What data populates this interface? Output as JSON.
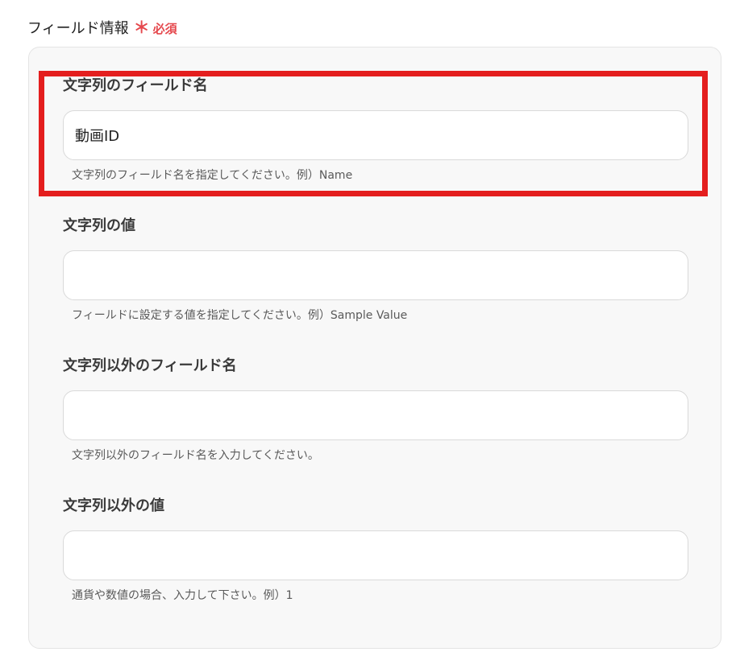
{
  "section": {
    "title": "フィールド情報",
    "required_mark": "＊",
    "required_text": "必須"
  },
  "fields": [
    {
      "label": "文字列のフィールド名",
      "value": "動画ID",
      "placeholder": "",
      "hint": "文字列のフィールド名を指定してください。例）Name"
    },
    {
      "label": "文字列の値",
      "value": "",
      "placeholder": "",
      "hint": "フィールドに設定する値を指定してください。例）Sample Value"
    },
    {
      "label": "文字列以外のフィールド名",
      "value": "",
      "placeholder": "",
      "hint": "文字列以外のフィールド名を入力してください。"
    },
    {
      "label": "文字列以外の値",
      "value": "",
      "placeholder": "",
      "hint": "通貨や数値の場合、入力して下さい。例）1"
    }
  ],
  "colors": {
    "required": "#e5484d",
    "highlight": "#e41e1e",
    "panel_bg": "#f8f8f8"
  }
}
